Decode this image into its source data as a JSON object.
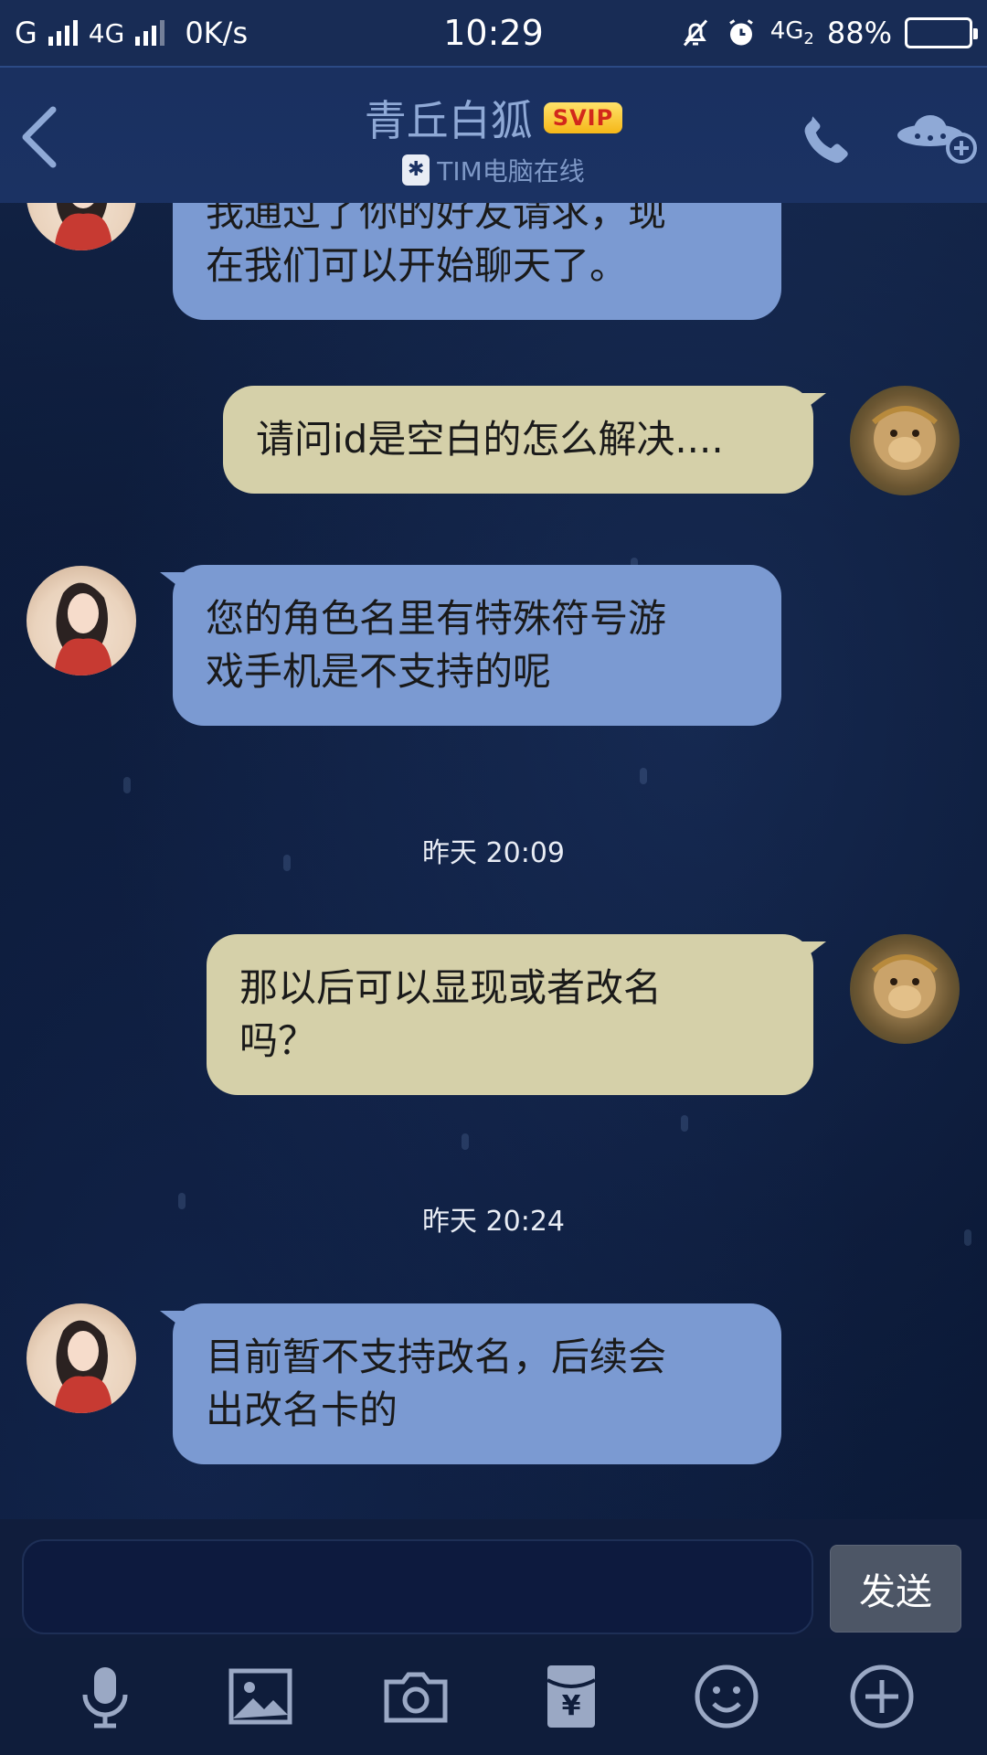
{
  "status_bar": {
    "carrier1": "G",
    "carrier2": "4G",
    "speed": "0K/s",
    "time": "10:29",
    "network": "4G",
    "network_sub": "2",
    "battery": "88%",
    "battery_level": 0.88
  },
  "header": {
    "title": "青丘白狐",
    "badge": "SVIP",
    "subtitle": "TIM电脑在线",
    "back_icon": "chevron-left-icon",
    "call_icon": "phone-icon",
    "more_icon": "ufo-add-icon"
  },
  "messages": [
    {
      "side": "in",
      "lines": [
        "我通过了你的好友请求，现",
        "在我们可以开始聊天了。"
      ]
    },
    {
      "side": "out",
      "lines": [
        "请问id是空白的怎么解决...."
      ]
    },
    {
      "side": "in",
      "lines": [
        "您的角色名里有特殊符号游",
        "戏手机是不支持的呢"
      ]
    },
    {
      "side": "out",
      "lines": [
        "那以后可以显现或者改名",
        "吗？"
      ]
    },
    {
      "side": "in",
      "lines": [
        "目前暂不支持改名，后续会",
        "出改名卡的"
      ]
    }
  ],
  "timestamps": [
    "昨天 20:09",
    "昨天 20:24"
  ],
  "input": {
    "value": "",
    "send_label": "发送"
  },
  "toolbar": {
    "icons": [
      "microphone-icon",
      "image-icon",
      "camera-icon",
      "red-packet-icon",
      "emoji-icon",
      "plus-icon"
    ]
  },
  "colors": {
    "incoming_bubble": "#7b9ad2",
    "outgoing_bubble": "#d5d0a9",
    "background": "#0d1a35",
    "svip_badge": "#f5c22a"
  }
}
